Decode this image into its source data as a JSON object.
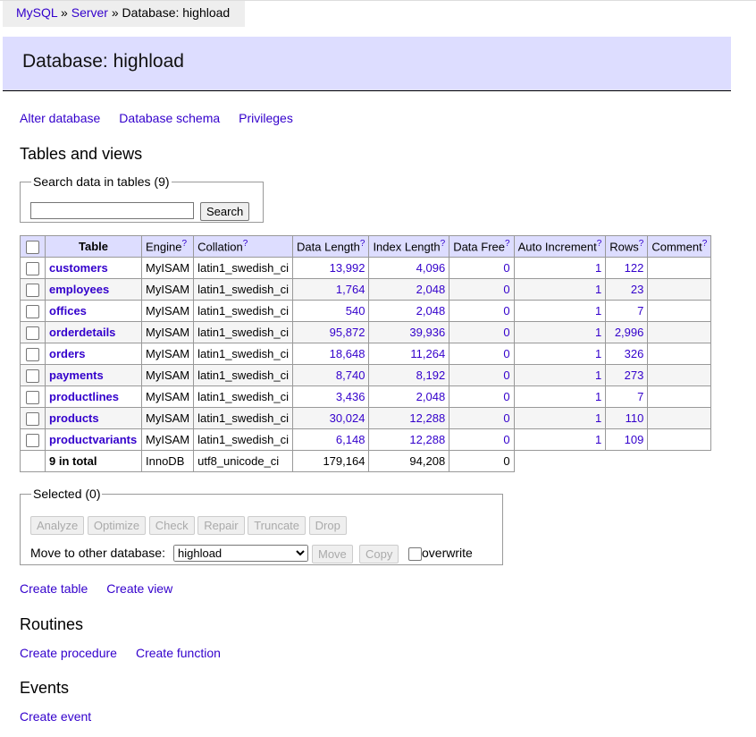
{
  "breadcrumb": {
    "mysql": "MySQL",
    "sep": "»",
    "server": "Server",
    "current": "Database: highload"
  },
  "title": "Database: highload",
  "top_links": [
    "Alter database",
    "Database schema",
    "Privileges"
  ],
  "tables_heading": "Tables and views",
  "search": {
    "legend": "Search data in tables (9)",
    "value": "",
    "button": "Search"
  },
  "columns": [
    "Table",
    "Engine",
    "Collation",
    "Data Length",
    "Index Length",
    "Data Free",
    "Auto Increment",
    "Rows",
    "Comment"
  ],
  "help_mark": "?",
  "rows": [
    [
      "customers",
      "MyISAM",
      "latin1_swedish_ci",
      "13,992",
      "4,096",
      "0",
      "1",
      "122",
      ""
    ],
    [
      "employees",
      "MyISAM",
      "latin1_swedish_ci",
      "1,764",
      "2,048",
      "0",
      "1",
      "23",
      ""
    ],
    [
      "offices",
      "MyISAM",
      "latin1_swedish_ci",
      "540",
      "2,048",
      "0",
      "1",
      "7",
      ""
    ],
    [
      "orderdetails",
      "MyISAM",
      "latin1_swedish_ci",
      "95,872",
      "39,936",
      "0",
      "1",
      "2,996",
      ""
    ],
    [
      "orders",
      "MyISAM",
      "latin1_swedish_ci",
      "18,648",
      "11,264",
      "0",
      "1",
      "326",
      ""
    ],
    [
      "payments",
      "MyISAM",
      "latin1_swedish_ci",
      "8,740",
      "8,192",
      "0",
      "1",
      "273",
      ""
    ],
    [
      "productlines",
      "MyISAM",
      "latin1_swedish_ci",
      "3,436",
      "2,048",
      "0",
      "1",
      "7",
      ""
    ],
    [
      "products",
      "MyISAM",
      "latin1_swedish_ci",
      "30,024",
      "12,288",
      "0",
      "1",
      "110",
      ""
    ],
    [
      "productvariants",
      "MyISAM",
      "latin1_swedish_ci",
      "6,148",
      "12,288",
      "0",
      "1",
      "109",
      ""
    ]
  ],
  "total": {
    "label": "9 in total",
    "engine": "InnoDB",
    "collation": "utf8_unicode_ci",
    "data_length": "179,164",
    "index_length": "94,208",
    "data_free": "0"
  },
  "selected": {
    "legend": "Selected (0)",
    "buttons": [
      "Analyze",
      "Optimize",
      "Check",
      "Repair",
      "Truncate",
      "Drop"
    ],
    "move_label": "Move to other database:",
    "db_value": "highload",
    "move": "Move",
    "copy": "Copy",
    "overwrite": "overwrite"
  },
  "create_links": [
    "Create table",
    "Create view"
  ],
  "routines_heading": "Routines",
  "routine_links": [
    "Create procedure",
    "Create function"
  ],
  "events_heading": "Events",
  "event_link": "Create event"
}
